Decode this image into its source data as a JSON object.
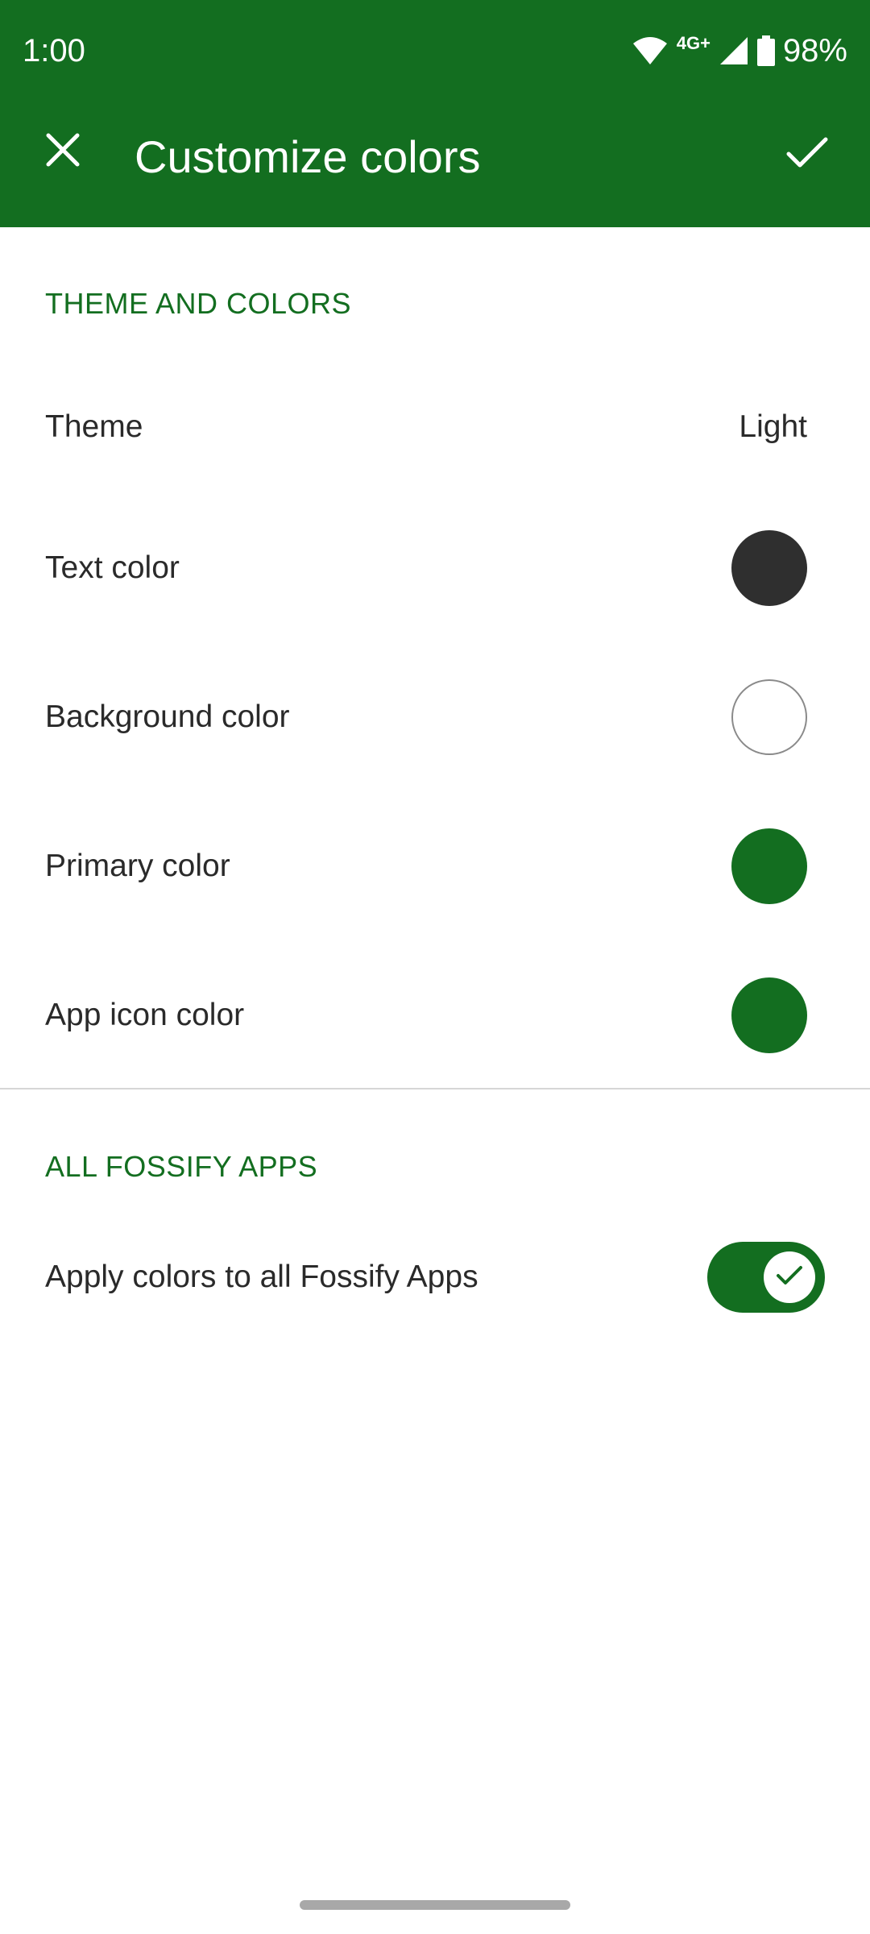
{
  "status_bar": {
    "time": "1:00",
    "network": "4G+",
    "battery": "98%",
    "icons": [
      "wifi-icon",
      "signal-icon",
      "battery-icon"
    ]
  },
  "app_bar": {
    "title": "Customize colors",
    "close_icon": "close-icon",
    "confirm_icon": "check-icon",
    "background": "#136e20"
  },
  "theme_section": {
    "header": "THEME AND COLORS",
    "rows": [
      {
        "label": "Theme",
        "value": "Light"
      },
      {
        "label": "Text color",
        "swatch": "#2f2f2f"
      },
      {
        "label": "Background color",
        "swatch": "#ffffff"
      },
      {
        "label": "Primary color",
        "swatch": "#136e20"
      },
      {
        "label": "App icon color",
        "swatch": "#136e20"
      }
    ]
  },
  "apps_section": {
    "header": "ALL FOSSIFY APPS",
    "apply_label": "Apply colors to all Fossify Apps",
    "apply_enabled": true
  },
  "colors": {
    "accent": "#136e20",
    "text": "#2a2a2a",
    "divider": "#d6d6d6"
  }
}
